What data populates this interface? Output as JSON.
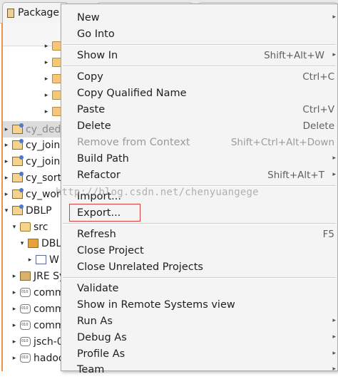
{
  "tab": {
    "title": "Package"
  },
  "tree": [
    {
      "indent": 0,
      "type": "folder",
      "label": "",
      "arrow": "▸"
    },
    {
      "indent": 0,
      "type": "folder",
      "label": "",
      "arrow": "▸"
    },
    {
      "indent": 0,
      "type": "folder",
      "label": "",
      "arrow": "▸"
    },
    {
      "indent": 0,
      "type": "folder",
      "label": "",
      "arrow": "▸"
    },
    {
      "indent": 0,
      "type": "folder",
      "label": "",
      "arrow": "▸"
    },
    {
      "indent": 0,
      "type": "project",
      "label": "cy_ded",
      "arrow": "▸",
      "selected": true
    },
    {
      "indent": 0,
      "type": "project",
      "label": "cy_join",
      "arrow": "▸"
    },
    {
      "indent": 0,
      "type": "project",
      "label": "cy_join",
      "arrow": "▸"
    },
    {
      "indent": 0,
      "type": "project",
      "label": "cy_sort",
      "arrow": "▸"
    },
    {
      "indent": 0,
      "type": "project",
      "label": "cy_wor",
      "arrow": "▸"
    },
    {
      "indent": 0,
      "type": "project",
      "label": "DBLP",
      "arrow": "▾"
    },
    {
      "indent": 1,
      "type": "src",
      "label": "src",
      "arrow": "▾"
    },
    {
      "indent": 2,
      "type": "pkg",
      "label": "DBL",
      "arrow": "▾"
    },
    {
      "indent": 3,
      "type": "java",
      "label": "W",
      "arrow": "▸"
    },
    {
      "indent": 1,
      "type": "jre",
      "label": "JRE Sy",
      "arrow": "▸"
    },
    {
      "indent": 1,
      "type": "jar",
      "label": "comm",
      "arrow": "▸"
    },
    {
      "indent": 1,
      "type": "jar",
      "label": "comm",
      "arrow": "▸"
    },
    {
      "indent": 1,
      "type": "jar",
      "label": "comm",
      "arrow": "▸"
    },
    {
      "indent": 1,
      "type": "jar",
      "label": "jsch-0",
      "arrow": "▸"
    },
    {
      "indent": 1,
      "type": "jar",
      "label": "hadoo",
      "arrow": "▸"
    }
  ],
  "menu": {
    "items": [
      {
        "label": "New",
        "submenu": true
      },
      {
        "label": "Go Into"
      },
      {
        "sep": true
      },
      {
        "label": "Show In",
        "shortcut": "Shift+Alt+W",
        "submenu": true
      },
      {
        "sep": true
      },
      {
        "label": "Copy",
        "shortcut": "Ctrl+C"
      },
      {
        "label": "Copy Qualified Name"
      },
      {
        "label": "Paste",
        "shortcut": "Ctrl+V"
      },
      {
        "label": "Delete",
        "shortcut": "Delete"
      },
      {
        "label": "Remove from Context",
        "shortcut": "Shift+Ctrl+Alt+Down",
        "disabled": true
      },
      {
        "label": "Build Path",
        "submenu": true
      },
      {
        "label": "Refactor",
        "shortcut": "Shift+Alt+T",
        "submenu": true
      },
      {
        "sep": true
      },
      {
        "label": "Import..."
      },
      {
        "label": "Export..."
      },
      {
        "sep": true
      },
      {
        "label": "Refresh",
        "shortcut": "F5"
      },
      {
        "label": "Close Project"
      },
      {
        "label": "Close Unrelated Projects"
      },
      {
        "sep": true
      },
      {
        "label": "Validate"
      },
      {
        "label": "Show in Remote Systems view"
      },
      {
        "label": "Run As",
        "submenu": true
      },
      {
        "label": "Debug As",
        "submenu": true
      },
      {
        "label": "Profile As",
        "submenu": true
      },
      {
        "label": "Team",
        "submenu": true
      }
    ]
  },
  "watermark": "http://blog.csdn.net/chenyuangege",
  "submenu_glyph": "▸"
}
